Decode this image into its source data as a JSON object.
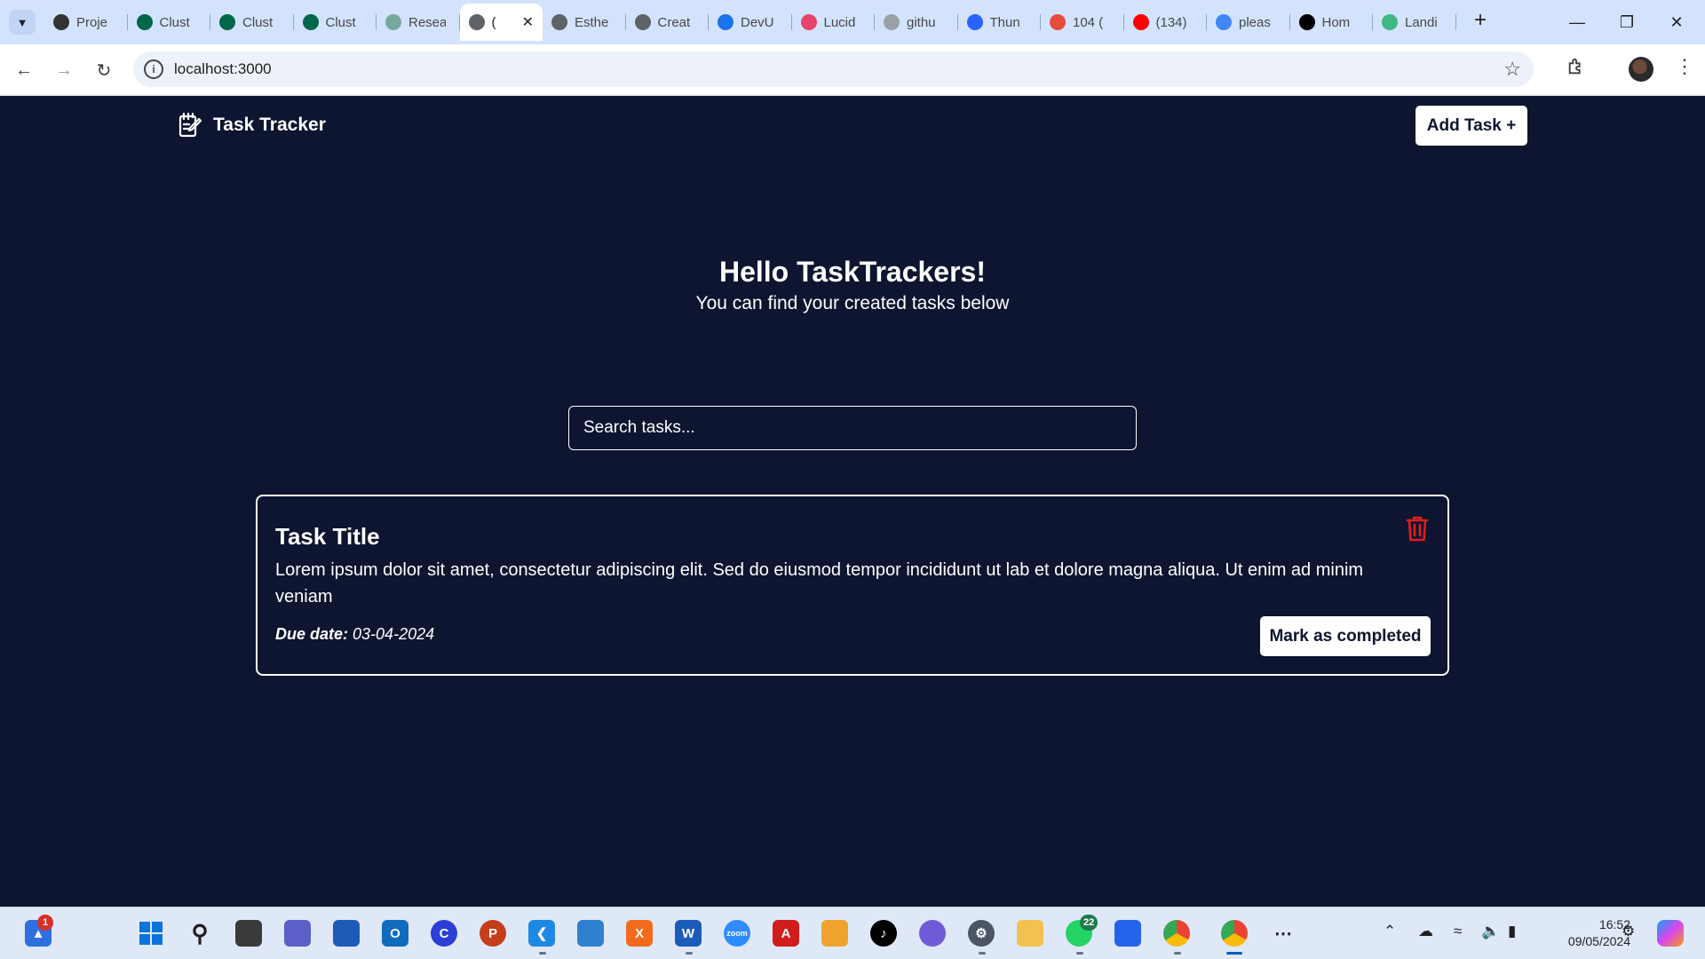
{
  "browser": {
    "tabs": [
      {
        "label": "Proje",
        "icon": "alx-icon",
        "color": "#333333"
      },
      {
        "label": "Clust",
        "icon": "mongodb-icon",
        "color": "#00684a"
      },
      {
        "label": "Clust",
        "icon": "mongodb-icon",
        "color": "#00684a"
      },
      {
        "label": "Clust",
        "icon": "mongodb-icon",
        "color": "#00684a"
      },
      {
        "label": "Resea",
        "icon": "openai-icon",
        "color": "#74aa9c"
      },
      {
        "label": "(",
        "icon": "globe-icon",
        "color": "#5f6368",
        "active": true
      },
      {
        "label": "Esthe",
        "icon": "globe-icon",
        "color": "#5f6368"
      },
      {
        "label": "Creat",
        "icon": "globe-icon",
        "color": "#5f6368"
      },
      {
        "label": "DevU",
        "icon": "devu-icon",
        "color": "#1a73e8"
      },
      {
        "label": "Lucid",
        "icon": "lucid-icon",
        "color": "#e8436b"
      },
      {
        "label": "githu",
        "icon": "globe-icon",
        "color": "#9aa0a6"
      },
      {
        "label": "Thun",
        "icon": "thunder-icon",
        "color": "#2962ff"
      },
      {
        "label": "104 (",
        "icon": "rainbow-icon",
        "color": "#e84c3d"
      },
      {
        "label": "(134)",
        "icon": "youtube-icon",
        "color": "#ff0000"
      },
      {
        "label": "pleas",
        "icon": "google-icon",
        "color": "#4285f4"
      },
      {
        "label": "Hom",
        "icon": "x-icon",
        "color": "#000000"
      },
      {
        "label": "Landi",
        "icon": "vue-icon",
        "color": "#41b883"
      }
    ],
    "url": "localhost:3000"
  },
  "app": {
    "brand": "Task Tracker",
    "add_task_label": "Add Task +",
    "hero_title": "Hello TaskTrackers!",
    "hero_subtitle": "You can find your created tasks below",
    "search_placeholder": "Search tasks...",
    "tasks": [
      {
        "title": "Task Title",
        "description": "Lorem ipsum dolor sit amet, consectetur adipiscing elit. Sed do eiusmod tempor incididunt ut lab et dolore magna aliqua. Ut enim ad minim veniam",
        "due_label": "Due date:",
        "due_date": "03-04-2024",
        "complete_label": "Mark as completed"
      }
    ],
    "colors": {
      "background": "#0d1530",
      "accent": "#ffffff",
      "delete": "#e11d1d"
    }
  },
  "taskbar": {
    "notification_badge": "1",
    "whatsapp_badge": "22",
    "time": "16:52",
    "date": "09/05/2024"
  }
}
